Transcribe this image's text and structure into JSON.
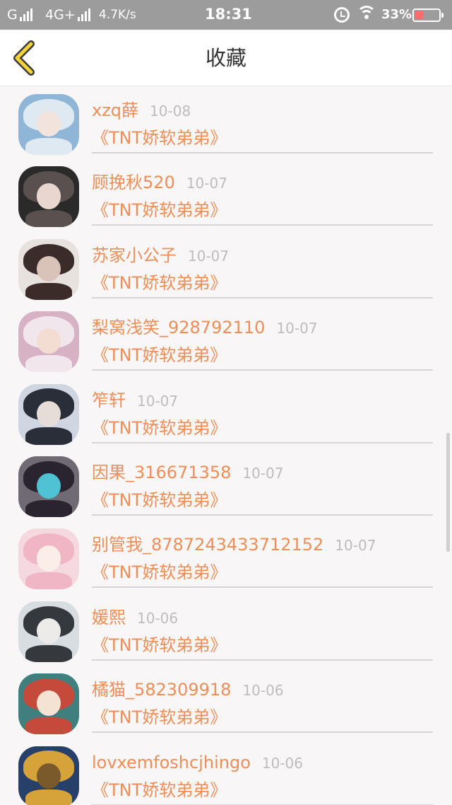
{
  "status_bar": {
    "carrier_g": "G",
    "network": "4G+",
    "speed": "4.7K/s",
    "time": "18:31",
    "battery": "33%"
  },
  "header": {
    "title": "收藏",
    "back_icon": "chevron-left-icon"
  },
  "items": [
    {
      "name": "xzq薛",
      "date": "10-08",
      "work": "《TNT娇软弟弟》",
      "avatar_colors": [
        "#8fb6d6",
        "#dfe9f2",
        "#f2e4dc"
      ]
    },
    {
      "name": "顾挽秋520",
      "date": "10-07",
      "work": "《TNT娇软弟弟》",
      "avatar_colors": [
        "#2a2a2a",
        "#5a5050",
        "#e9d6cf"
      ]
    },
    {
      "name": "苏家小公子",
      "date": "10-07",
      "work": "《TNT娇软弟弟》",
      "avatar_colors": [
        "#e8e2df",
        "#3b2c2a",
        "#d9c2b8"
      ]
    },
    {
      "name": "梨窝浅笑_928792110",
      "date": "10-07",
      "work": "《TNT娇软弟弟》",
      "avatar_colors": [
        "#d7b2c4",
        "#f0e6ec",
        "#f3ddd3"
      ]
    },
    {
      "name": "笮轩",
      "date": "10-07",
      "work": "《TNT娇软弟弟》",
      "avatar_colors": [
        "#cfd6e2",
        "#2a2e38",
        "#e6dcd8"
      ]
    },
    {
      "name": "因果_316671358",
      "date": "10-07",
      "work": "《TNT娇软弟弟》",
      "avatar_colors": [
        "#6f6a74",
        "#2a2430",
        "#4fc3d4"
      ]
    },
    {
      "name": "别管我_8787243433712152",
      "date": "10-07",
      "work": "《TNT娇软弟弟》",
      "avatar_colors": [
        "#f6d8e0",
        "#f0b6c6",
        "#fbeee8"
      ]
    },
    {
      "name": "媛熙",
      "date": "10-06",
      "work": "《TNT娇软弟弟》",
      "avatar_colors": [
        "#d8dde2",
        "#35393e",
        "#ecebe9"
      ]
    },
    {
      "name": "橘猫_582309918",
      "date": "10-06",
      "work": "《TNT娇软弟弟》",
      "avatar_colors": [
        "#3f7f7d",
        "#c64a3c",
        "#f4e2d2"
      ]
    },
    {
      "name": "lovxemfoshcjhingo",
      "date": "10-06",
      "work": "《TNT娇软弟弟》",
      "avatar_colors": [
        "#27406a",
        "#d6a33a",
        "#7a5a2a"
      ]
    }
  ]
}
